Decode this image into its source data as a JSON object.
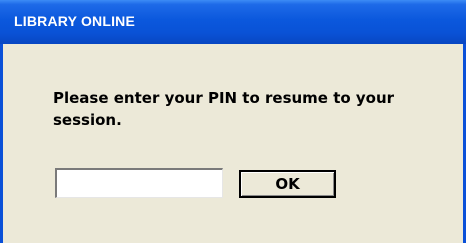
{
  "window": {
    "title": "LIBRARY ONLINE"
  },
  "dialog": {
    "message": "Please enter your PIN to resume to your session.",
    "pin_input": {
      "value": "",
      "placeholder": ""
    },
    "ok_label": "OK"
  },
  "colors": {
    "titlebar": "#0a52d6",
    "window_border": "#0a50d8",
    "dialog_background": "#ece9d8",
    "title_text": "#ffffff"
  }
}
